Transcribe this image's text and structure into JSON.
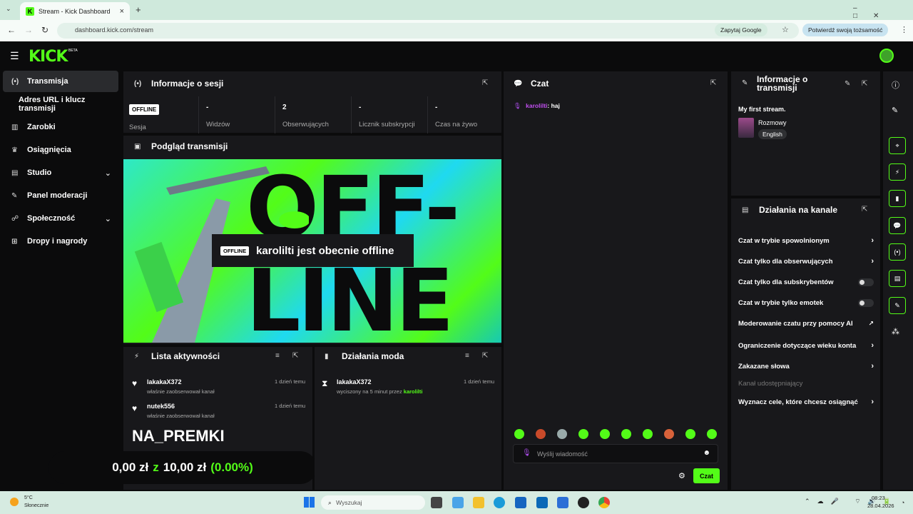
{
  "browser": {
    "tab_title": "Stream - Kick Dashboard",
    "tab_favicon": "K",
    "url": "dashboard.kick.com/stream",
    "ask_google": "Zapytaj Google",
    "verify_identity": "Potwierdź swoją tożsamość"
  },
  "header": {
    "logo": "KICK",
    "beta": "BETA"
  },
  "sidebar": {
    "items": [
      {
        "label": "Transmisja",
        "icon": "broadcast-icon"
      },
      {
        "label": "Adres URL i klucz transmisji",
        "icon": ""
      },
      {
        "label": "Zarobki",
        "icon": "chart-icon"
      },
      {
        "label": "Osiągnięcia",
        "icon": "trophy-icon"
      },
      {
        "label": "Studio",
        "icon": "studio-icon"
      },
      {
        "label": "Panel moderacji",
        "icon": "wrench-icon"
      },
      {
        "label": "Społeczność",
        "icon": "community-icon"
      },
      {
        "label": "Dropy i nagrody",
        "icon": "gift-icon"
      }
    ]
  },
  "session": {
    "title": "Informacje o sesji",
    "status_badge": "OFFLINE",
    "status_label": "Sesja",
    "stats": [
      {
        "value": "-",
        "label": "Widzów"
      },
      {
        "value": "2",
        "label": "Obserwujących"
      },
      {
        "value": "-",
        "label": "Licznik subskrypcji"
      },
      {
        "value": "-",
        "label": "Czas na żywo"
      }
    ]
  },
  "preview": {
    "title": "Podgląd transmisji",
    "overlay_badge": "OFFLINE",
    "overlay_text": "karolilti jest obecnie offline",
    "bg_text_1": "OFF-",
    "bg_text_2": "LINE"
  },
  "activity": {
    "title": "Lista aktywności",
    "items": [
      {
        "user": "lakakaX372",
        "action": "właśnie zaobserwował kanał",
        "time": "1 dzień temu"
      },
      {
        "user": "nutek556",
        "action": "właśnie zaobserwował kanał",
        "time": "1 dzień temu"
      }
    ],
    "overlay_title": "NA_PREMKI",
    "overlay_amount": "0,00 zł",
    "overlay_of": "z",
    "overlay_goal": "10,00 zł",
    "overlay_percent": "(0.00%)"
  },
  "mod": {
    "title": "Działania moda",
    "items": [
      {
        "user": "lakakaX372",
        "action": "wyciszony na 5 minut przez",
        "by": "karolilti",
        "time": "1 dzień temu"
      }
    ]
  },
  "chat": {
    "title": "Czat",
    "messages": [
      {
        "user": "karolilti",
        "text": ": haj"
      }
    ],
    "input_placeholder": "Wyślij wiadomość",
    "send": "Czat"
  },
  "stream_info": {
    "title": "Informacje o transmisji",
    "stream_title": "My first stream.",
    "category": "Rozmowy",
    "language": "English"
  },
  "channel_actions": {
    "title": "Działania na kanale",
    "items": [
      {
        "label": "Czat w trybie spowolnionym",
        "control": "arrow"
      },
      {
        "label": "Czat tylko dla obserwujących",
        "control": "arrow"
      },
      {
        "label": "Czat tylko dla subskrybentów",
        "control": "toggle"
      },
      {
        "label": "Czat w trybie tylko emotek",
        "control": "toggle"
      },
      {
        "label": "Moderowanie czatu przy pomocy AI",
        "control": "external"
      },
      {
        "label": "Ograniczenie dotyczące wieku konta",
        "control": "arrow"
      },
      {
        "label": "Zakazane słowa",
        "control": "arrow"
      },
      {
        "label": "Kanał udostępniający",
        "control": "none"
      },
      {
        "label": "Wyznacz cele, które chcesz osiągnąć",
        "control": "arrow"
      }
    ]
  },
  "taskbar": {
    "weather_temp": "5°C",
    "weather_desc": "Słonecznie",
    "search_placeholder": "Wyszukaj",
    "clock_time": "08:23",
    "clock_date": "28.04.2026"
  },
  "colors": {
    "accent": "#53fc18",
    "panel": "#18181b",
    "background": "#0b0b0c"
  }
}
